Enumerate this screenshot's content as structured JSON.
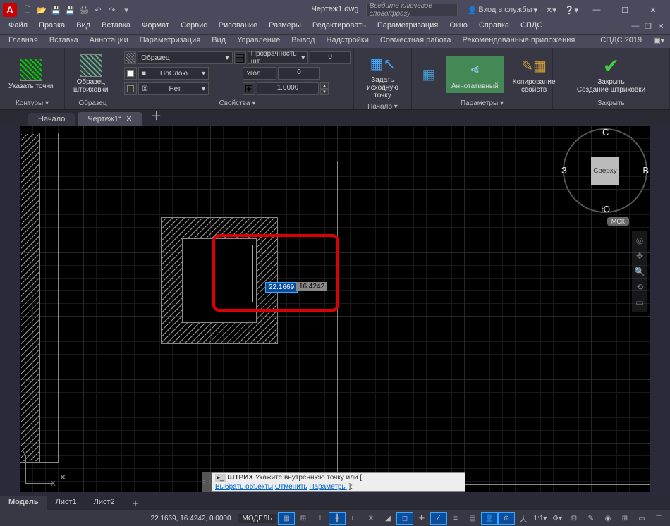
{
  "titlebar": {
    "filename": "Чертеж1.dwg",
    "search_placeholder": "Введите ключевое слово/фразу",
    "signin": "Вход в службы"
  },
  "menus": [
    "Файл",
    "Правка",
    "Вид",
    "Вставка",
    "Формат",
    "Сервис",
    "Рисование",
    "Размеры",
    "Редактировать",
    "Параметризация",
    "Окно",
    "Справка",
    "СПДС"
  ],
  "ribbon_tabs": [
    "Главная",
    "Вставка",
    "Аннотации",
    "Параметризация",
    "Вид",
    "Управление",
    "Вывод",
    "Надстройки",
    "Совместная работа",
    "Рекомендованные приложения",
    "СПДС 2019"
  ],
  "ribbon": {
    "pick_points": "Указать точки",
    "panel_contours": "Контуры",
    "hatch_sample": "Образец\nштриховки",
    "panel_sample": "Образец",
    "pattern_dd": "Образец",
    "color_dd": "ПоСлою",
    "layer_dd": "Нет",
    "panel_props": "Свойства",
    "transp_label": "Прозрачность шт...",
    "transp_val": "0",
    "angle_label": "Угол",
    "angle_val": "0",
    "scale_val": "1.0000",
    "origin": "Задать\nисходную точку",
    "panel_origin": "Начало",
    "annotative": "Аннотативный",
    "copy_props": "Копирование\nсвойств",
    "panel_params": "Параметры",
    "close": "Закрыть\nСоздание штриховки",
    "panel_close": "Закрыть"
  },
  "doc_tabs": {
    "start": "Начало",
    "active": "Чертеж1*"
  },
  "dynamic": {
    "x": "22.1669",
    "y": "16.4242"
  },
  "viewcube": {
    "top": "Сверху",
    "n": "С",
    "s": "Ю",
    "e": "В",
    "w": "З",
    "wcs": "МСК"
  },
  "cmdline": {
    "prefix": "ШТРИХ",
    "line1_rest": " Укажите внутреннюю точку или [",
    "kw1": "Выбрать объекты",
    "kw2": "Отменить",
    "kw3": "Параметры",
    "suffix": "]:"
  },
  "layout_tabs": [
    "Модель",
    "Лист1",
    "Лист2"
  ],
  "statusbar": {
    "coords": "22.1669, 16.4242, 0.0000",
    "model": "МОДЕЛЬ"
  }
}
